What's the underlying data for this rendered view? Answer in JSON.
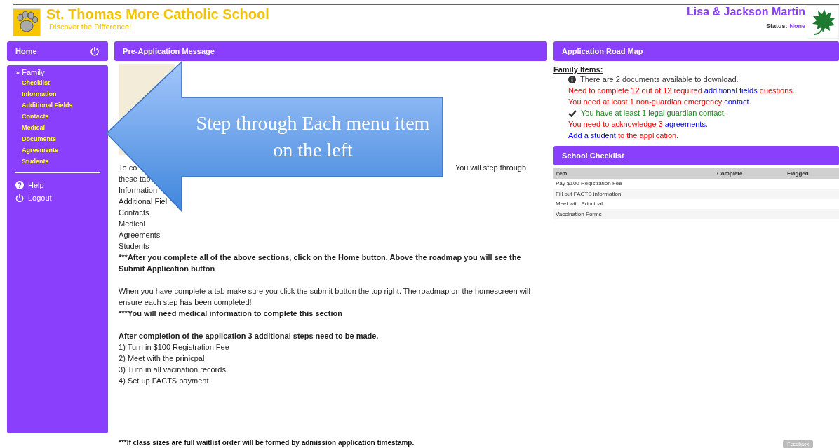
{
  "header": {
    "school_name": "St. Thomas More Catholic School",
    "tagline": "Discover the Difference!",
    "family_name": "Lisa & Jackson Martin",
    "status_label": "Status:",
    "status_value": "None"
  },
  "sidebar": {
    "home": "Home",
    "section": {
      "label": "Family",
      "marker": "»",
      "items": [
        {
          "label": "Checklist"
        },
        {
          "label": "Information"
        },
        {
          "label": "Additional Fields"
        },
        {
          "label": "Contacts"
        },
        {
          "label": "Medical"
        },
        {
          "label": "Documents"
        },
        {
          "label": "Agreements"
        },
        {
          "label": "Students"
        }
      ]
    },
    "links": [
      {
        "label": "Help",
        "kind": "help"
      },
      {
        "label": "Logout",
        "kind": "logout"
      }
    ]
  },
  "message": {
    "title": "Pre-Application Message",
    "intro_left": "To co",
    "intro_right": "You will step through",
    "lines": [
      "these tab",
      "Information",
      "Additional Fiel",
      "Contacts",
      "Medical",
      "Agreements",
      "Students"
    ],
    "blocks": [
      {
        "paragraphs": [
          {
            "bold": true,
            "text": " ***After you complete all of the above sections, click on the Home button. Above the roadmap you will see the Submit Application button"
          }
        ]
      },
      {
        "paragraphs": [
          {
            "bold": false,
            "text": "When you have complete a tab make sure you click the submit button the top right.  The roadmap on the homescreen will ensure each step has been completed!"
          },
          {
            "bold": true,
            "text": "***You will need medical information to complete this section"
          }
        ]
      },
      {
        "paragraphs": [
          {
            "bold": true,
            "text": "After completion of the application 3 additional steps need to be made."
          },
          {
            "bold": false,
            "text": "1) Turn in $100 Registration Fee"
          },
          {
            "bold": false,
            "text": "2) Meet with the prinicpal"
          },
          {
            "bold": false,
            "text": "3) Turn in all vacination records"
          },
          {
            "bold": false,
            "text": "4) Set up FACTS payment"
          }
        ]
      }
    ],
    "footnote": "***If class sizes are full waitlist order will be formed by admission application timestamp."
  },
  "callout": {
    "text": "Step through Each menu item on the left"
  },
  "roadmap": {
    "title": "Application Road Map",
    "heading": "Family Items:",
    "items": [
      {
        "kind": "info",
        "parts": [
          {
            "text": "There are 2 documents available to download.",
            "link": false
          }
        ]
      },
      {
        "kind": "todo",
        "parts": [
          {
            "text": "Need to complete 12 out of 12 required ",
            "link": false
          },
          {
            "text": "additional fields",
            "link": true
          },
          {
            "text": " questions.",
            "link": false
          }
        ]
      },
      {
        "kind": "todo",
        "parts": [
          {
            "text": "You need at least 1 non-guardian emergency ",
            "link": false
          },
          {
            "text": "contact",
            "link": true
          },
          {
            "text": ".",
            "link": false
          }
        ]
      },
      {
        "kind": "done",
        "parts": [
          {
            "text": "You have at least 1 legal guardian contact.",
            "link": false
          }
        ]
      },
      {
        "kind": "todo",
        "parts": [
          {
            "text": "You need to acknowledge 3 ",
            "link": false
          },
          {
            "text": "agreements",
            "link": true
          },
          {
            "text": ".",
            "link": false
          }
        ]
      },
      {
        "kind": "todo",
        "parts": [
          {
            "text": "Add a student",
            "link": true
          },
          {
            "text": " to the application.",
            "link": false
          }
        ]
      }
    ]
  },
  "checklist": {
    "title": "School Checklist",
    "columns": [
      "Item",
      "Complete",
      "Flagged"
    ],
    "rows": [
      {
        "item": "Pay $100 Registration Fee"
      },
      {
        "item": "Fill out FACTS information"
      },
      {
        "item": "Meet with Principal"
      },
      {
        "item": "Vaccination Forms"
      }
    ]
  },
  "feedback": "Feedback"
}
